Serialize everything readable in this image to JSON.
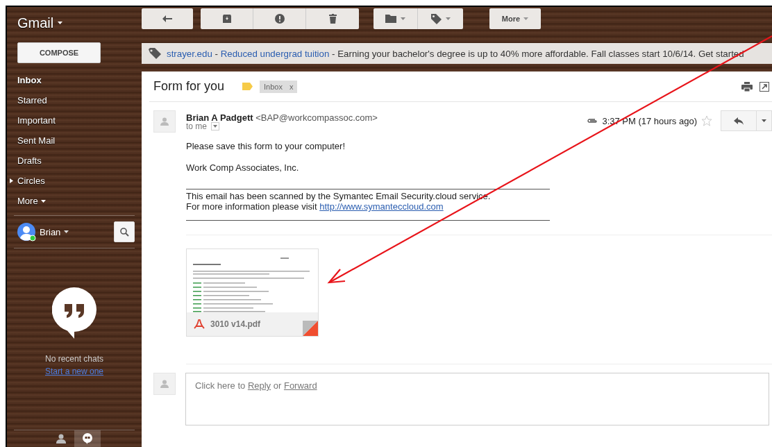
{
  "app": {
    "title": "Gmail"
  },
  "toolbar": {
    "more": "More"
  },
  "compose": "COMPOSE",
  "nav": [
    {
      "label": "Inbox",
      "selected": true,
      "kind": "plain"
    },
    {
      "label": "Starred",
      "selected": false,
      "kind": "plain"
    },
    {
      "label": "Important",
      "selected": false,
      "kind": "plain"
    },
    {
      "label": "Sent Mail",
      "selected": false,
      "kind": "plain"
    },
    {
      "label": "Drafts",
      "selected": false,
      "kind": "plain"
    },
    {
      "label": "Circles",
      "selected": false,
      "kind": "group",
      "expanded": false
    },
    {
      "label": "More",
      "selected": false,
      "kind": "more"
    }
  ],
  "user": {
    "name": "Brian"
  },
  "chat": {
    "empty": "No recent chats",
    "link": "Start a new one",
    "tabs": [
      {
        "kind": "contacts",
        "selected": false
      },
      {
        "kind": "hangouts",
        "selected": true
      }
    ]
  },
  "ad": {
    "site": "strayer.edu",
    "separator": "-",
    "headline": "Reduced undergrad tuition",
    "text": "- Earning your bachelor's degree is up to 40% more affordable. Fall classes start 10/6/14. Get started"
  },
  "thread": {
    "subject": "Form for you",
    "labels": [
      {
        "text": "Inbox",
        "remove": "x"
      }
    ]
  },
  "message": {
    "sender": "Brian A Padgett",
    "email": "<BAP@workcompassoc.com>",
    "to": "to me",
    "time": "3:37 PM (17 hours ago)",
    "starred": false,
    "body": [
      "Please save this form to your computer!",
      "Work Comp Associates, Inc."
    ],
    "footer": {
      "line1": "This email has been scanned by the Symantec Email Security.cloud service.",
      "line2": "For more information please visit",
      "link": "http://www.symanteccloud.com"
    },
    "attachment": {
      "name": "3010 v14.pdf"
    }
  },
  "reply": {
    "prefix": "Click here to",
    "reply": "Reply",
    "or": "or",
    "forward": "Forward"
  }
}
